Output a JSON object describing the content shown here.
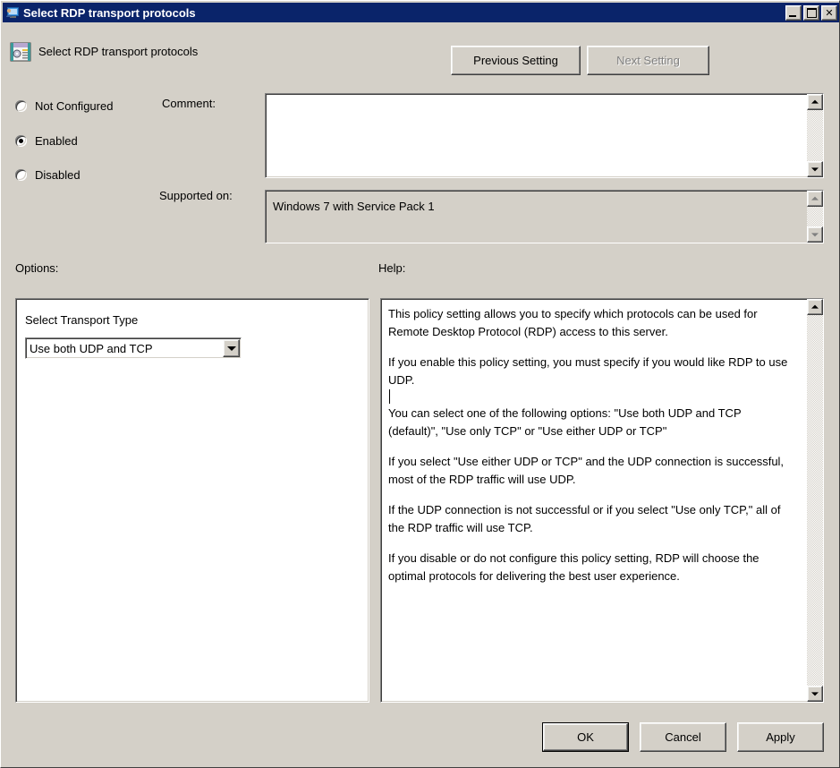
{
  "window": {
    "title": "Select RDP transport protocols",
    "title_icon": "remote-desktop-icon",
    "minimize_label": "Minimize",
    "maximize_label": "Maximize",
    "close_label": "Close",
    "close_glyph": "✕"
  },
  "header": {
    "icon": "policy-setting-icon",
    "title": "Select RDP transport protocols"
  },
  "nav": {
    "previous_label": "Previous Setting",
    "next_label": "Next Setting",
    "next_disabled": true
  },
  "state": {
    "options": [
      {
        "id": "not-configured",
        "label": "Not Configured",
        "selected": false
      },
      {
        "id": "enabled",
        "label": "Enabled",
        "selected": true
      },
      {
        "id": "disabled",
        "label": "Disabled",
        "selected": false
      }
    ]
  },
  "comment": {
    "label": "Comment:",
    "value": ""
  },
  "supported_on": {
    "label": "Supported on:",
    "value": "Windows 7 with Service Pack 1"
  },
  "options_panel": {
    "label": "Options:",
    "setting_label": "Select Transport Type",
    "combo_value": "Use both UDP and TCP",
    "combo_options": [
      "Use both UDP and TCP",
      "Use only TCP",
      "Use either UDP or TCP"
    ]
  },
  "help_panel": {
    "label": "Help:",
    "paragraphs": [
      "This policy setting allows you to specify which protocols can be used for Remote Desktop Protocol (RDP) access to this server.",
      "If you enable this policy setting, you must specify if you would like RDP to use UDP.",
      "You can select one of the following options: \"Use both UDP and TCP (default)\", \"Use only TCP\" or \"Use either UDP or TCP\"",
      "If you select \"Use either UDP or TCP\" and the UDP connection is successful, most of the RDP traffic will use UDP.",
      "If the UDP connection is not successful or if you select \"Use only TCP,\" all of the RDP traffic will use TCP.",
      "If you disable or do not configure this policy setting, RDP will choose the optimal protocols for delivering the best user experience."
    ]
  },
  "footer": {
    "ok_label": "OK",
    "cancel_label": "Cancel",
    "apply_label": "Apply"
  },
  "colors": {
    "titlebar": "#0a246a",
    "dialog_face": "#d4d0c8",
    "field_bg": "#ffffff",
    "disabled_text": "#808080"
  }
}
